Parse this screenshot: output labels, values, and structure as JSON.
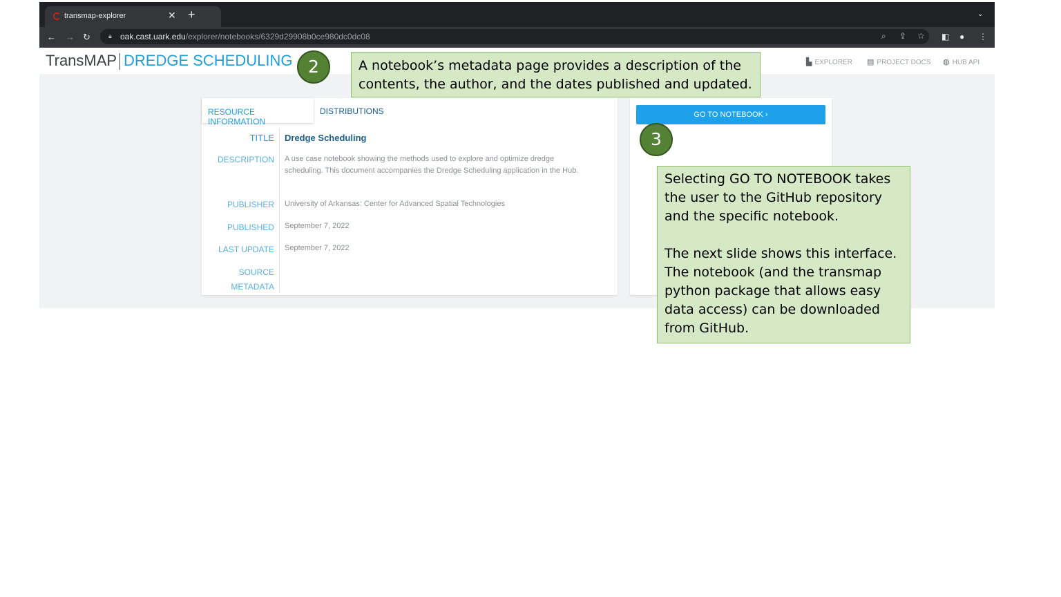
{
  "browser": {
    "tab_title": "transmap-explorer",
    "tab_close": "✕",
    "new_tab": "+",
    "url_host": "oak.cast.uark.edu",
    "url_path": "/explorer/notebooks/6329d29908b0ce980dc0dc08"
  },
  "app": {
    "logo_trans": "TransMAP",
    "logo_dredge": "DREDGE SCHEDULING",
    "nav": [
      {
        "label": "EXPLORER",
        "icon": "map-icon"
      },
      {
        "label": "PROJECT DOCS",
        "icon": "book-icon"
      },
      {
        "label": "HUB API",
        "icon": "api-icon"
      }
    ]
  },
  "resource": {
    "tabs": [
      "RESOURCE INFORMATION",
      "DISTRIBUTIONS"
    ],
    "title_label": "TITLE",
    "title_value": "Dredge Scheduling",
    "description_label": "DESCRIPTION",
    "description_value": "A use case notebook showing the methods used to explore and optimize dredge scheduling. This document accompanies the Dredge Scheduling application in the Hub.",
    "publisher_label": "PUBLISHER",
    "publisher_value": "University of Arkansas: Center for Advanced Spatial Technologies",
    "published_label": "PUBLISHED",
    "published_value": "September 7, 2022",
    "last_update_label": "LAST UPDATE",
    "last_update_value": "September 7, 2022",
    "source_label_1": "SOURCE",
    "source_label_2": "METADATA"
  },
  "actions": {
    "go_to_notebook": "GO TO NOTEBOOK  ›"
  },
  "annotations": {
    "step2": "2",
    "step3": "3",
    "callout1": "A notebook’s metadata page provides a description of the contents, the author, and the dates published and updated.",
    "callout2_p1": "Selecting GO TO NOTEBOOK takes the user to the GitHub repository and the specific notebook.",
    "callout2_p2": "The next slide shows this interface. The notebook (and the transmap python package that allows easy data access) can be downloaded from GitHub."
  }
}
